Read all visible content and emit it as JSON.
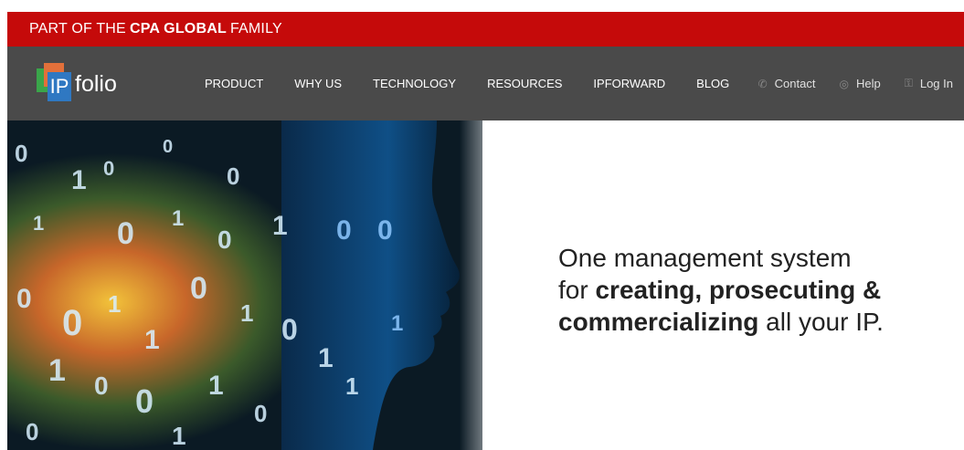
{
  "topbar": {
    "prefix": "PART OF THE",
    "brand": "CPA GLOBAL",
    "suffix": "FAMILY"
  },
  "logo": {
    "ip": "IP",
    "text": "folio"
  },
  "nav": {
    "items": [
      {
        "label": "PRODUCT"
      },
      {
        "label": "WHY US"
      },
      {
        "label": "TECHNOLOGY"
      },
      {
        "label": "RESOURCES"
      },
      {
        "label": "IPFORWARD"
      },
      {
        "label": "BLOG"
      }
    ],
    "utility": [
      {
        "label": "Contact",
        "icon": "phone-icon"
      },
      {
        "label": "Help",
        "icon": "help-icon"
      },
      {
        "label": "Log In",
        "icon": "key-icon"
      }
    ]
  },
  "hero": {
    "line1": "One management system",
    "line2_pre": "for ",
    "line2_bold": "creating, prosecuting &",
    "line3_bold": "commercializing",
    "line3_post": " all your IP."
  },
  "colors": {
    "topbar": "#c50a0a",
    "nav": "#4a4a4a",
    "logo_green": "#3aa54a",
    "logo_orange": "#e2703a",
    "logo_blue": "#2f78c2"
  }
}
